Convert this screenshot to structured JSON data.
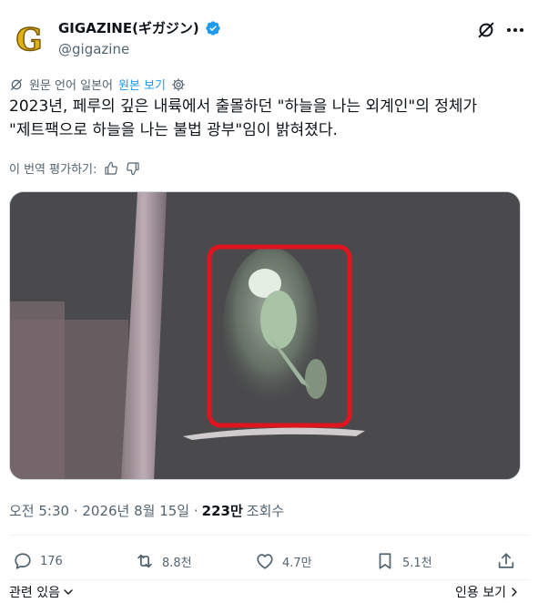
{
  "author": {
    "display_name": "GIGAZINE(ギガジン)",
    "handle": "@gigazine",
    "avatar_letter": "G",
    "verified": true
  },
  "translation": {
    "notice": "원문 언어 일본어",
    "show_original": "원본 보기"
  },
  "tweet": {
    "text_line1": "2023년, 페루의 깊은 내륙에서 출몰하던 \"하늘을 나는 외계인\"의 정체가",
    "text_line2": "\"제트팩으로 하늘을 나는 불법 광부\"임이 밝혀졌다."
  },
  "rating": {
    "label": "이 번역 평가하기:"
  },
  "meta": {
    "time_date": "오전 5:30 · 2026년 8월 15일 ·",
    "views_count": "223만",
    "views_label": "조회수"
  },
  "actions": {
    "reply_count": "176",
    "retweet_count": "8.8천",
    "like_count": "4.7만",
    "bookmark_count": "5.1천"
  },
  "footer": {
    "related": "관련 있음",
    "quotes": "인용 보기"
  },
  "colors": {
    "accent": "#1d9bf0",
    "text_primary": "#0f1419",
    "text_secondary": "#536471",
    "highlight_box": "#e0141e"
  }
}
